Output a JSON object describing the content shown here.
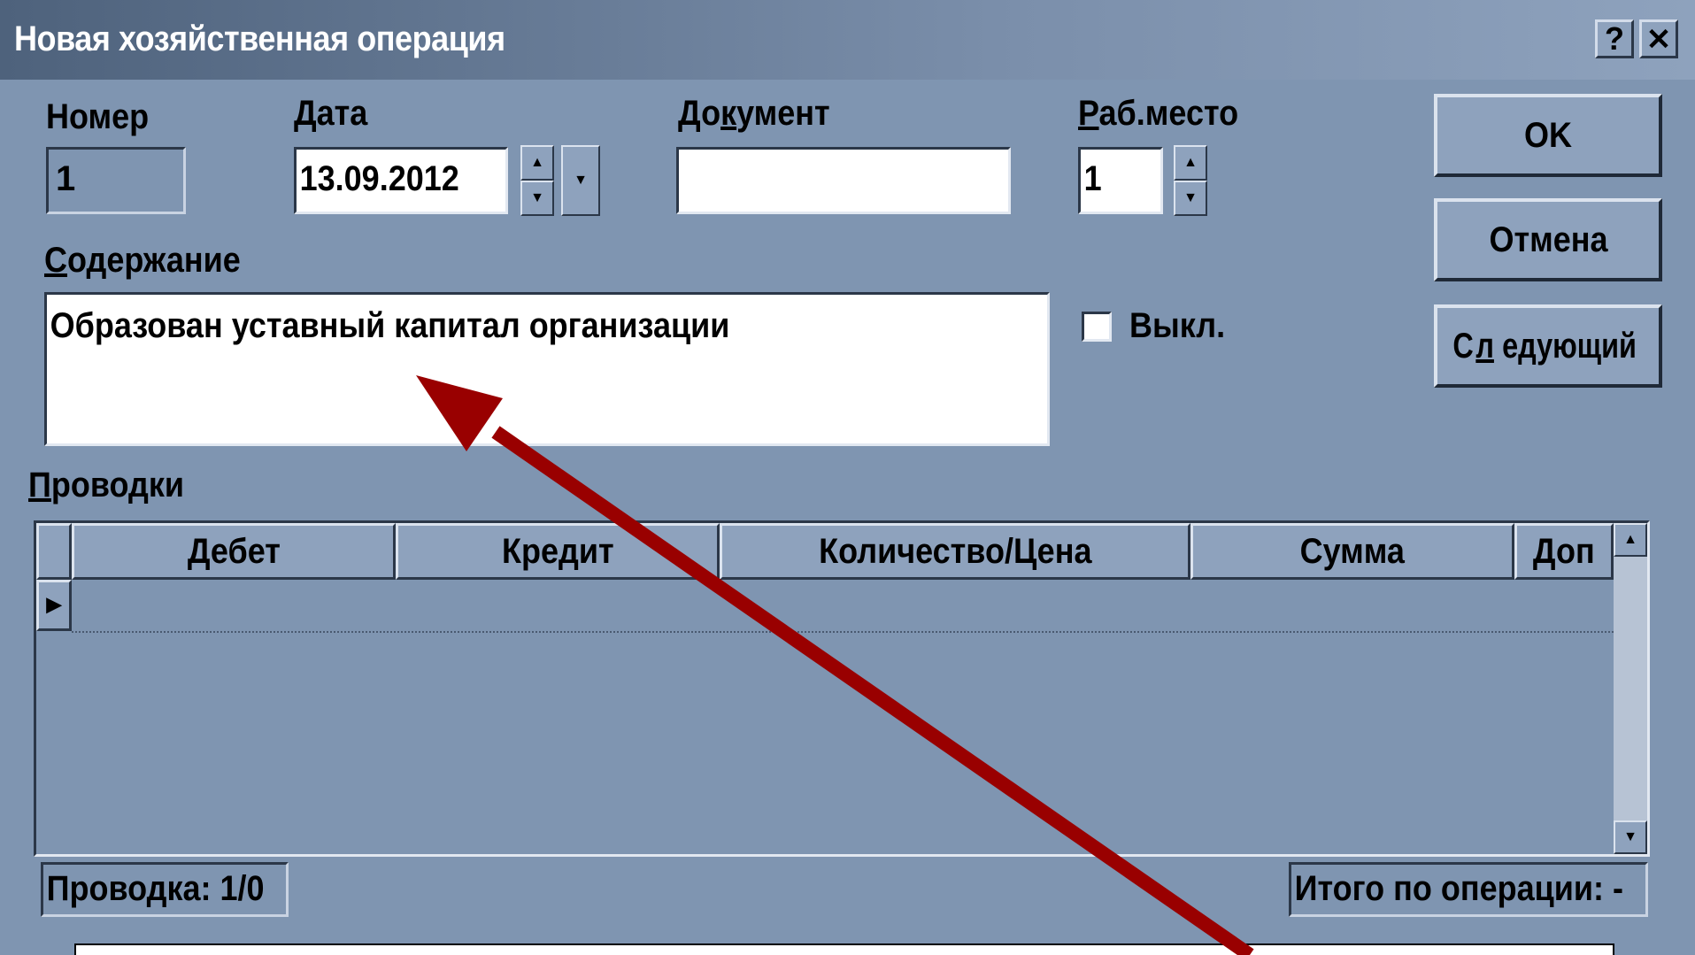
{
  "window": {
    "title": "Новая хозяйственная операция",
    "help_label": "?",
    "close_label": "✕"
  },
  "fields": {
    "number": {
      "label": "Номер",
      "value": "1"
    },
    "date": {
      "label_hotkey": "Д",
      "label_rest": "ата",
      "value": "13.09.2012"
    },
    "document": {
      "label_pre": "До",
      "label_hotkey": "к",
      "label_post": "умент",
      "value": ""
    },
    "workplace": {
      "label_hotkey": "Р",
      "label_rest": "аб.место",
      "value": "1"
    },
    "content": {
      "label_hotkey": "С",
      "label_rest": "одержание",
      "value": "Образован уставный капитал организации"
    },
    "disabled": {
      "label": "Выкл.",
      "checked": false
    }
  },
  "buttons": {
    "ok": "OK",
    "cancel": "Отмена",
    "next_pre": "С",
    "next_hotkey": "л",
    "next_post": "едующий"
  },
  "entries": {
    "label_hotkey": "П",
    "label_rest": "роводки",
    "columns": [
      "Дебет",
      "Кредит",
      "Количество/Цена",
      "Сумма",
      "Доп"
    ],
    "rows": [],
    "current_row_marker": "▶"
  },
  "status_bar": {
    "entry_counter": "Проводка: 1/0",
    "total": "Итого по операции: -"
  },
  "colors": {
    "window_bg": "#7f95b1",
    "titlebar_text": "#ffffff",
    "arrow": "#990000"
  }
}
